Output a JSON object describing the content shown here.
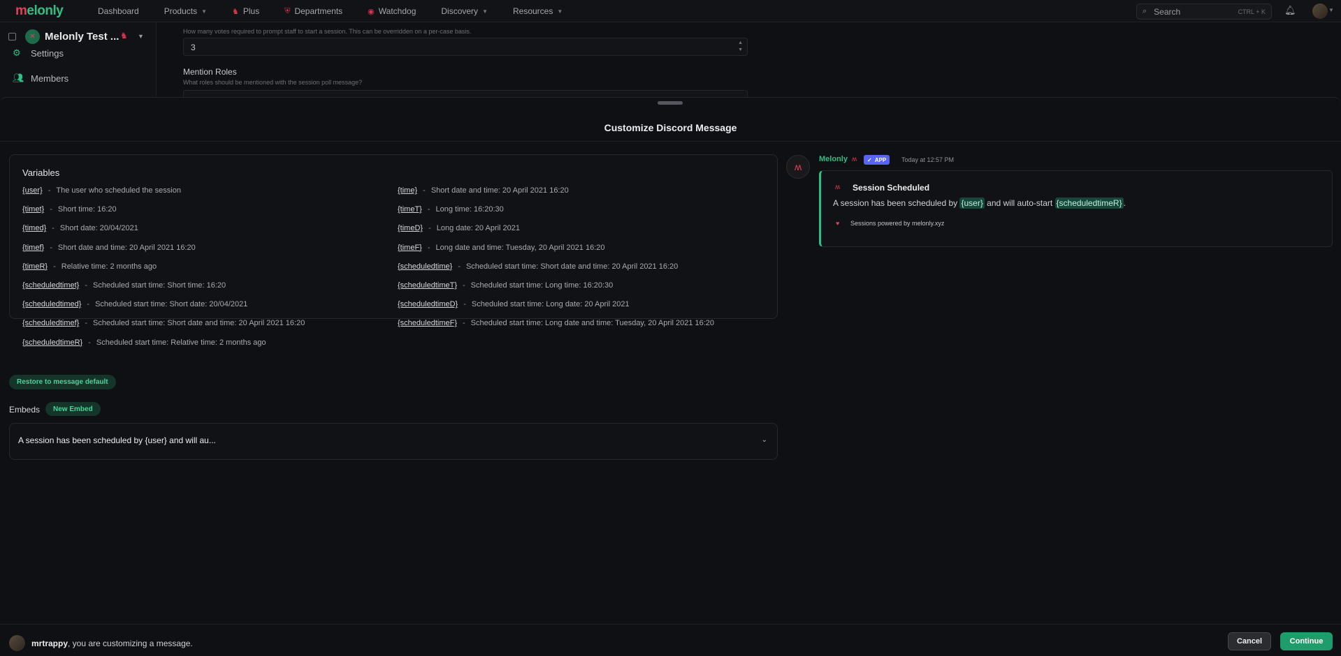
{
  "topnav": {
    "brand": "elonly",
    "brand_mark": "m",
    "items": [
      {
        "label": "Dashboard",
        "has_chevron": false
      },
      {
        "label": "Products",
        "has_chevron": true
      },
      {
        "label": "Plus",
        "has_chevron": false
      },
      {
        "label": "Departments",
        "has_chevron": false
      },
      {
        "label": "Watchdog",
        "has_chevron": false
      },
      {
        "label": "Discovery",
        "has_chevron": true
      },
      {
        "label": "Resources",
        "has_chevron": true
      }
    ],
    "search_placeholder": "Search",
    "search_shortcut": "CTRL + K"
  },
  "sidebar": {
    "server_name": "Melonly Test ...",
    "items": [
      {
        "label": "Settings",
        "icon": "gear-icon"
      },
      {
        "label": "Members",
        "icon": "users-icon"
      }
    ]
  },
  "background_settings": {
    "votes_hint": "How many votes required to prompt staff to start a session. This can be overridden on a per-case basis.",
    "votes_value": "3",
    "mention_roles_label": "Mention Roles",
    "mention_roles_hint": "What roles should be mentioned with the session poll message?"
  },
  "modal": {
    "title": "Customize Discord Message",
    "variables_title": "Variables",
    "variables": [
      {
        "name": "{user}",
        "desc": "The user who scheduled the session"
      },
      {
        "name": "{time}",
        "desc": "Short date and time: 20 April 2021 16:20"
      },
      {
        "name": "{timet}",
        "desc": "Short time: 16:20"
      },
      {
        "name": "{timeT}",
        "desc": "Long time: 16:20:30"
      },
      {
        "name": "{timed}",
        "desc": "Short date: 20/04/2021"
      },
      {
        "name": "{timeD}",
        "desc": "Long date: 20 April 2021"
      },
      {
        "name": "{timef}",
        "desc": "Short date and time: 20 April 2021 16:20"
      },
      {
        "name": "{timeF}",
        "desc": "Long date and time: Tuesday, 20 April 2021 16:20"
      },
      {
        "name": "{timeR}",
        "desc": "Relative time: 2 months ago"
      },
      {
        "name": "{scheduledtime}",
        "desc": "Scheduled start time: Short date and time: 20 April 2021 16:20"
      },
      {
        "name": "{scheduledtimet}",
        "desc": "Scheduled start time: Short time: 16:20"
      },
      {
        "name": "{scheduledtimeT}",
        "desc": "Scheduled start time: Long time: 16:20:30"
      },
      {
        "name": "{scheduledtimed}",
        "desc": "Scheduled start time: Short date: 20/04/2021"
      },
      {
        "name": "{scheduledtimeD}",
        "desc": "Scheduled start time: Long date: 20 April 2021"
      },
      {
        "name": "{scheduledtimef}",
        "desc": "Scheduled start time: Short date and time: 20 April 2021 16:20"
      },
      {
        "name": "{scheduledtimeF}",
        "desc": "Scheduled start time: Long date and time: Tuesday, 20 April 2021 16:20"
      },
      {
        "name": "{scheduledtimeR}",
        "desc": "Scheduled start time: Relative time: 2 months ago"
      }
    ],
    "dash": "-",
    "restore_label": "Restore to message default",
    "embeds_label": "Embeds",
    "new_embed_label": "New Embed",
    "embed_summary": "A session has been scheduled by {user} and will au..."
  },
  "preview": {
    "bot_name": "Melonly",
    "app_tag": "APP",
    "timestamp": "Today at 12:57 PM",
    "embed": {
      "title": "Session Scheduled",
      "desc_part1": "A session has been scheduled by ",
      "mention_user": "{user}",
      "desc_part2": " and will auto-start ",
      "mention_time": "{scheduledtimeR}",
      "desc_part3": ".",
      "footer": "Sessions powered by melonly.xyz"
    },
    "accent_color": "#2fbf85"
  },
  "bottom": {
    "username": "mrtrappy",
    "message": ", you are customizing a message.",
    "cancel_label": "Cancel",
    "continue_label": "Continue"
  }
}
